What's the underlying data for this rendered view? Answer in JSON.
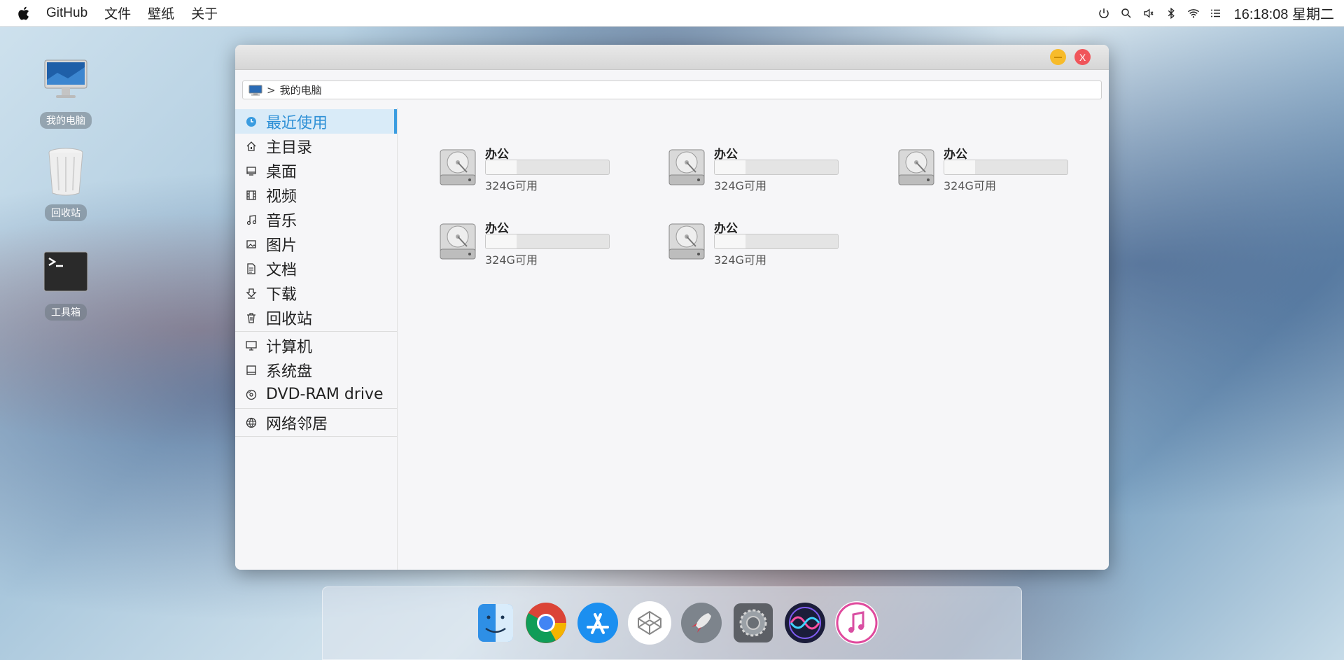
{
  "menubar": {
    "apple_icon": "apple-icon",
    "items": [
      "GitHub",
      "文件",
      "壁纸",
      "关于"
    ],
    "status_icons": [
      "power-icon",
      "search-icon",
      "volume-icon",
      "bluetooth-icon",
      "wifi-icon",
      "list-icon"
    ],
    "clock": "16:18:08 星期二"
  },
  "desktop": {
    "icons": [
      {
        "label": "我的电脑",
        "icon": "computer-icon"
      },
      {
        "label": "回收站",
        "icon": "trash-icon"
      },
      {
        "label": "工具箱",
        "icon": "terminal-icon"
      }
    ]
  },
  "window": {
    "close_label": "X",
    "path": {
      "separator": ">",
      "current": "我的电脑"
    },
    "sidebar": {
      "places": [
        {
          "label": "最近使用",
          "icon": "clock-icon",
          "active": true
        },
        {
          "label": "主目录",
          "icon": "home-icon"
        },
        {
          "label": "桌面",
          "icon": "desktop-icon"
        },
        {
          "label": "视频",
          "icon": "video-icon"
        },
        {
          "label": "音乐",
          "icon": "music-icon"
        },
        {
          "label": "图片",
          "icon": "picture-icon"
        },
        {
          "label": "文档",
          "icon": "document-icon"
        },
        {
          "label": "下载",
          "icon": "download-icon"
        },
        {
          "label": "回收站",
          "icon": "trash-icon"
        }
      ],
      "devices": [
        {
          "label": "计算机",
          "icon": "monitor-icon"
        },
        {
          "label": "系统盘",
          "icon": "drive-icon"
        },
        {
          "label": "DVD-RAM drive",
          "icon": "disc-icon"
        }
      ],
      "network": [
        {
          "label": "网络邻居",
          "icon": "network-icon"
        }
      ]
    },
    "drives": [
      {
        "name": "办公",
        "free": "324G可用",
        "used_fraction": 0.25
      },
      {
        "name": "办公",
        "free": "324G可用",
        "used_fraction": 0.25
      },
      {
        "name": "办公",
        "free": "324G可用",
        "used_fraction": 0.25
      },
      {
        "name": "办公",
        "free": "324G可用",
        "used_fraction": 0.25
      },
      {
        "name": "办公",
        "free": "324G可用",
        "used_fraction": 0.25
      }
    ]
  },
  "dock": {
    "apps": [
      "finder-icon",
      "chrome-icon",
      "app-store-icon",
      "codepen-icon",
      "launchpad-icon",
      "system-preferences-icon",
      "siri-icon",
      "itunes-icon"
    ]
  },
  "colors": {
    "accent": "#3a9ce0",
    "close": "#f0555a",
    "minimize": "#f7bb2a"
  }
}
